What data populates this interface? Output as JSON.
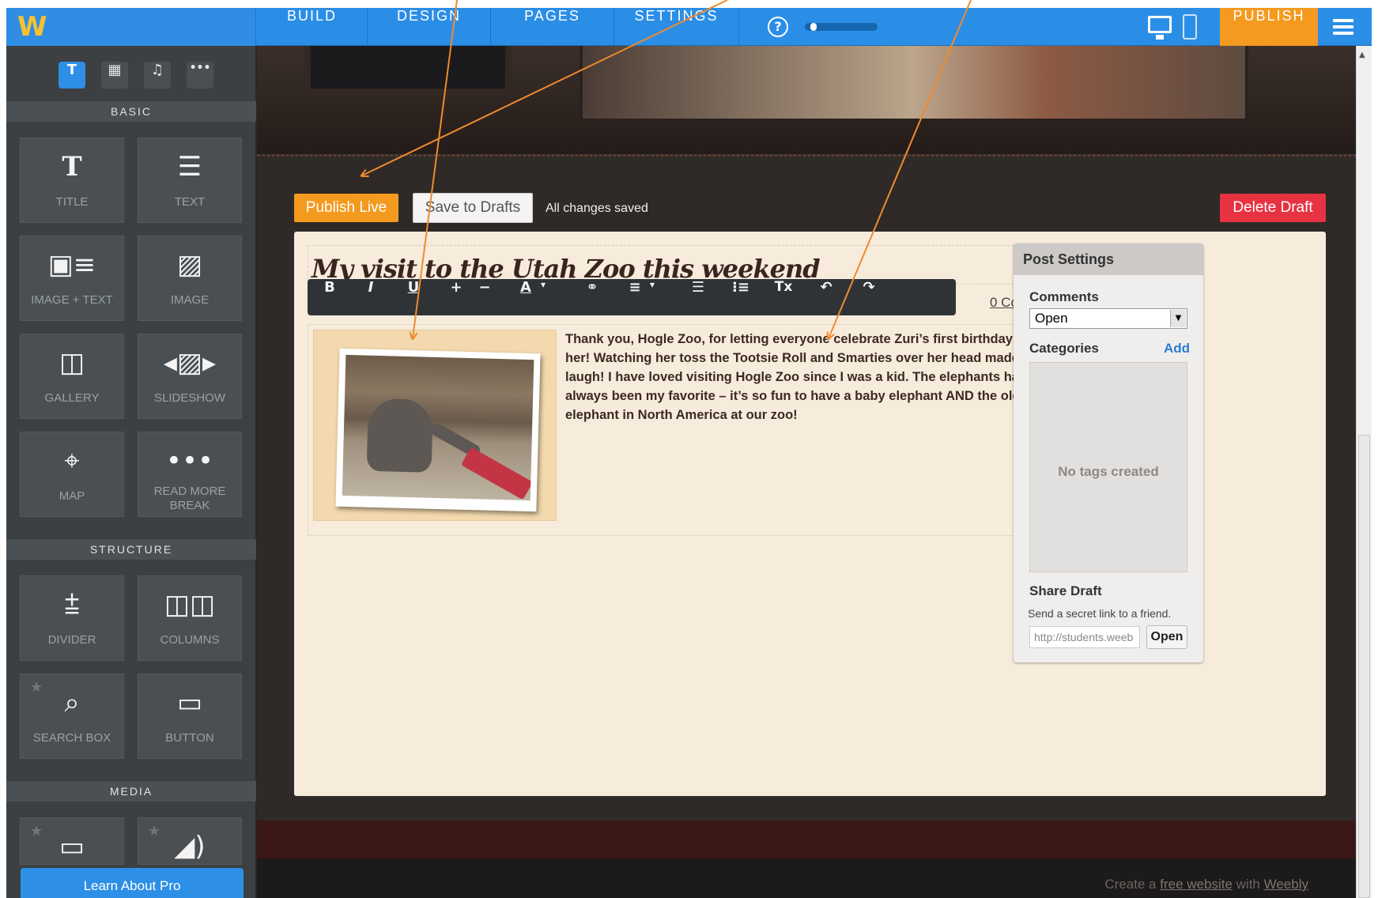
{
  "topbar": {
    "logo": "W",
    "tabs": [
      "BUILD",
      "DESIGN",
      "PAGES",
      "SETTINGS"
    ],
    "help": "?",
    "publish": "PUBLISH",
    "progress": 0.08
  },
  "sidebar": {
    "tool_tabs": [
      "T",
      "▦",
      "♫",
      "•••"
    ],
    "sections": {
      "basic": "BASIC",
      "structure": "STRUCTURE",
      "media": "MEDIA"
    },
    "elements": [
      {
        "label": "TITLE",
        "icon": "title-icon"
      },
      {
        "label": "TEXT",
        "icon": "text-icon"
      },
      {
        "label": "IMAGE + TEXT",
        "icon": "image-text-icon"
      },
      {
        "label": "IMAGE",
        "icon": "image-icon"
      },
      {
        "label": "GALLERY",
        "icon": "gallery-icon"
      },
      {
        "label": "SLIDESHOW",
        "icon": "slideshow-icon"
      },
      {
        "label": "MAP",
        "icon": "map-icon"
      },
      {
        "label": "READ MORE BREAK",
        "icon": "read-more-icon"
      },
      {
        "label": "DIVIDER",
        "icon": "divider-icon"
      },
      {
        "label": "COLUMNS",
        "icon": "columns-icon"
      },
      {
        "label": "SEARCH BOX",
        "icon": "search-icon"
      },
      {
        "label": "BUTTON",
        "icon": "button-icon"
      }
    ],
    "learn_pro": "Learn About Pro"
  },
  "editor": {
    "publish_live": "Publish Live",
    "save_drafts": "Save to Drafts",
    "status": "All changes saved",
    "delete_draft": "Delete Draft",
    "post_title": "My visit to the Utah Zoo this weekend",
    "comments_link": "0 Comments",
    "toolbar": [
      "B",
      "I",
      "U",
      "+",
      "−",
      "A",
      "▾",
      "⚭",
      "≡",
      "▾",
      "☰",
      "⁝≡",
      "Tx",
      "↶",
      "↷"
    ],
    "body_text": "Thank you, Hogle Zoo, for letting everyone celebrate Zuri’s first birthday with her!  Watching her toss the Tootsie Roll and Smarties over her head made me laugh!  I have loved visiting Hogle Zoo since I was a kid.  The elephants have always been my favorite – it’s so fun to have a baby elephant AND the oldest elephant in North America at our zoo!"
  },
  "post_settings": {
    "title": "Post Settings",
    "comments_label": "Comments",
    "comments_value": "Open",
    "categories_label": "Categories",
    "add_label": "Add",
    "no_tags": "No tags created",
    "share_label": "Share Draft",
    "share_hint": "Send a secret link to a friend.",
    "share_url": "http://students.weeb",
    "open_label": "Open"
  },
  "footer": {
    "prefix": "Create a ",
    "link1": "free website",
    "middle": " with ",
    "link2": "Weebly"
  },
  "colors": {
    "brand_blue": "#2b8ee6",
    "publish_orange": "#f39a1f",
    "delete_red": "#e63241",
    "annotation_arrow": "#f08a2e"
  }
}
